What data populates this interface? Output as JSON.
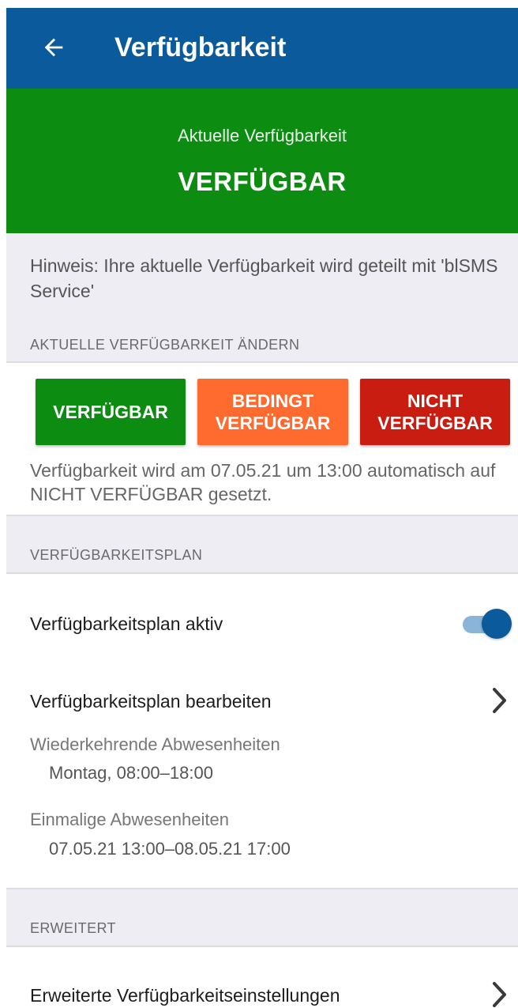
{
  "appbar": {
    "back_icon": "arrow-left-icon",
    "title": "Verfügbarkeit"
  },
  "status": {
    "caption": "Aktuelle Verfügbarkeit",
    "value": "VERFÜGBAR",
    "color": "#0d8c12"
  },
  "hint": {
    "text": "Hinweis: Ihre aktuelle Verfügbarkeit wird geteilt mit 'blSMS Service'"
  },
  "change_section": {
    "header": "AKTUELLE VERFÜGBARKEIT ÄNDERN",
    "buttons": {
      "available": {
        "label": "VERFÜGBAR",
        "color": "#0d8c12"
      },
      "conditional": {
        "line1": "BEDINGT",
        "line2": "VERFÜGBAR",
        "color": "#ff6a2e"
      },
      "unavailable": {
        "line1": "NICHT",
        "line2": "VERFÜGBAR",
        "color": "#c91d12"
      }
    },
    "auto_note": "Verfügbarkeit wird am 07.05.21 um 13:00 automatisch auf NICHT VERFÜGBAR gesetzt."
  },
  "plan_section": {
    "header": "VERFÜGBARKEITSPLAN",
    "active_label": "Verfügbarkeitsplan aktiv",
    "active_switch_on": true,
    "edit_label": "Verfügbarkeitsplan bearbeiten",
    "recurring_label": "Wiederkehrende Abwesenheiten",
    "recurring_value": "Montag, 08:00–18:00",
    "onetime_label": "Einmalige Abwesenheiten",
    "onetime_value": "07.05.21 13:00–08.05.21 17:00"
  },
  "advanced_section": {
    "header": "ERWEITERT",
    "settings_label": "Erweiterte Verfügbarkeitseinstellungen"
  },
  "icons": {
    "chevron": "chevron-right-icon"
  }
}
